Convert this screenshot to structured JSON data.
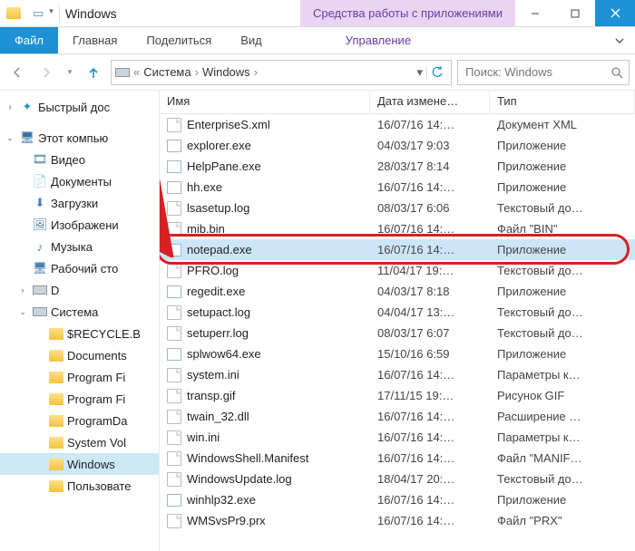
{
  "window": {
    "title": "Windows",
    "context_tab": "Средства работы с приложениями"
  },
  "ribbon": {
    "file": "Файл",
    "tabs": [
      "Главная",
      "Поделиться",
      "Вид"
    ],
    "context": "Управление"
  },
  "nav": {
    "crumbs": [
      "Система",
      "Windows"
    ],
    "search_placeholder": "Поиск: Windows"
  },
  "sidebar": {
    "quick": "Быстрый дос",
    "pc": "Этот компью",
    "items": [
      {
        "label": "Видео",
        "icon": "video"
      },
      {
        "label": "Документы",
        "icon": "doc"
      },
      {
        "label": "Загрузки",
        "icon": "down"
      },
      {
        "label": "Изображени",
        "icon": "pic"
      },
      {
        "label": "Музыка",
        "icon": "music"
      },
      {
        "label": "Рабочий сто",
        "icon": "desk"
      },
      {
        "label": "D",
        "icon": "drive"
      },
      {
        "label": "Система",
        "icon": "drive",
        "expanded": true
      }
    ],
    "sys_children": [
      "$RECYCLE.B",
      "Documents",
      "Program Fi",
      "Program Fi",
      "ProgramDa",
      "System Vol",
      "Windows",
      "Пользовате"
    ],
    "selected_child": "Windows"
  },
  "columns": {
    "name": "Имя",
    "date": "Дата измене…",
    "type": "Тип"
  },
  "files": [
    {
      "name": "EnterpriseS.xml",
      "date": "16/07/16 14:…",
      "type": "Документ XML",
      "icon": "file"
    },
    {
      "name": "explorer.exe",
      "date": "04/03/17 9:03",
      "type": "Приложение",
      "icon": "app"
    },
    {
      "name": "HelpPane.exe",
      "date": "28/03/17 8:14",
      "type": "Приложение",
      "icon": "app"
    },
    {
      "name": "hh.exe",
      "date": "16/07/16 14:…",
      "type": "Приложение",
      "icon": "app"
    },
    {
      "name": "lsasetup.log",
      "date": "08/03/17 6:06",
      "type": "Текстовый до…",
      "icon": "file"
    },
    {
      "name": "mib.bin",
      "date": "16/07/16 14:…",
      "type": "Файл \"BIN\"",
      "icon": "file"
    },
    {
      "name": "notepad.exe",
      "date": "16/07/16 14:…",
      "type": "Приложение",
      "icon": "app",
      "selected": true
    },
    {
      "name": "PFRO.log",
      "date": "11/04/17 19:…",
      "type": "Текстовый до…",
      "icon": "file"
    },
    {
      "name": "regedit.exe",
      "date": "04/03/17 8:18",
      "type": "Приложение",
      "icon": "app"
    },
    {
      "name": "setupact.log",
      "date": "04/04/17 13:…",
      "type": "Текстовый до…",
      "icon": "file"
    },
    {
      "name": "setuperr.log",
      "date": "08/03/17 6:07",
      "type": "Текстовый до…",
      "icon": "file"
    },
    {
      "name": "splwow64.exe",
      "date": "15/10/16 6:59",
      "type": "Приложение",
      "icon": "app"
    },
    {
      "name": "system.ini",
      "date": "16/07/16 14:…",
      "type": "Параметры к…",
      "icon": "file"
    },
    {
      "name": "transp.gif",
      "date": "17/11/15 19:…",
      "type": "Рисунок GIF",
      "icon": "file"
    },
    {
      "name": "twain_32.dll",
      "date": "16/07/16 14:…",
      "type": "Расширение …",
      "icon": "file"
    },
    {
      "name": "win.ini",
      "date": "16/07/16 14:…",
      "type": "Параметры к…",
      "icon": "file"
    },
    {
      "name": "WindowsShell.Manifest",
      "date": "16/07/16 14:…",
      "type": "Файл \"MANIF…",
      "icon": "file"
    },
    {
      "name": "WindowsUpdate.log",
      "date": "18/04/17 20:…",
      "type": "Текстовый до…",
      "icon": "file"
    },
    {
      "name": "winhlp32.exe",
      "date": "16/07/16 14:…",
      "type": "Приложение",
      "icon": "app"
    },
    {
      "name": "WMSvsPr9.prx",
      "date": "16/07/16 14:…",
      "type": "Файл \"PRX\"",
      "icon": "file"
    }
  ]
}
